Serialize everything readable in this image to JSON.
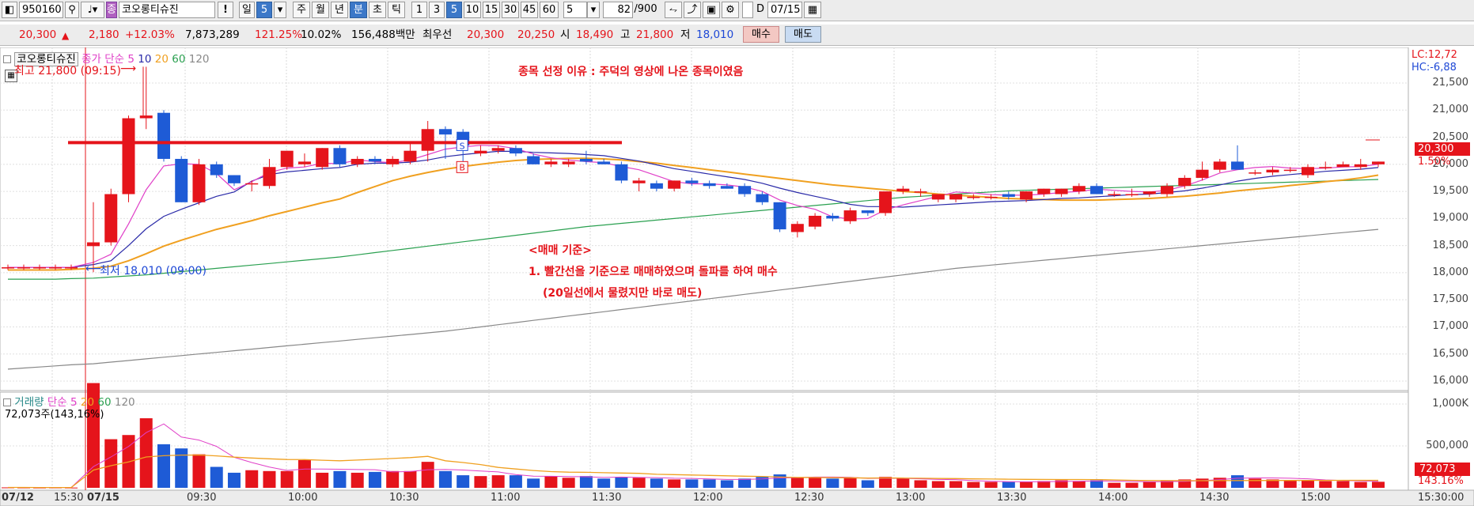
{
  "toolbar": {
    "code": "950160",
    "stock_name": "코오롱티슈진",
    "bang": "!",
    "day": "일",
    "day_count": "5",
    "week": "주",
    "month": "월",
    "year": "년",
    "minute": "분",
    "second": "초",
    "tick": "틱",
    "intervals": [
      "1",
      "3",
      "5",
      "10",
      "15",
      "30",
      "45",
      "60"
    ],
    "interval_value": "5",
    "count_value": "82",
    "count_total": "/900",
    "d_label": "D",
    "date": "07/15"
  },
  "infobar": {
    "price": "20,300",
    "change_arrow": "▲",
    "change": "2,180",
    "change_pct": "+12.03%",
    "volume": "7,873,289",
    "volume_ratio": "121.25%",
    "turnover": "10.02%",
    "trade_value": "156,488백만",
    "best_label": "최우선",
    "best_ask": "20,300",
    "best_bid": "20,250",
    "open_label": "시",
    "open": "18,490",
    "high_label": "고",
    "high": "21,800",
    "low_label": "저",
    "low": "18,010",
    "buy_button": "매수",
    "sell_button": "매도"
  },
  "price_legend": {
    "name": "코오롱티슈진",
    "close_label": "종가 단순",
    "ma5": "5",
    "ma10": "10",
    "ma20": "20",
    "ma60": "60",
    "ma120": "120"
  },
  "volume_legend": {
    "label": "거래량",
    "simple": "단순",
    "ma5": "5",
    "ma20": "20",
    "ma60": "60",
    "ma120": "120",
    "current": "72,073주(143,16%)"
  },
  "annotations": {
    "high_marker": "최고 21,800 (09:15)",
    "low_marker": "최저 18,010 (09:00)",
    "reason": "종목 선정 이유 : 주덕의 영상에 나온 종목이였음",
    "rule_title": "<매매 기준>",
    "rule_1": "1. 빨간선을 기준으로 매매하였으며 돌파를 하여 매수",
    "rule_2": "(20일선에서 물렸지만 바로 매도)",
    "lc": "LC:12,72",
    "hc": "HC:-6,88",
    "price_tag": "20,300",
    "pct_tag": "1.50%",
    "vol_tag": "72,073",
    "vol_pct_tag": "143.16%",
    "s_marker": "S",
    "b_marker": "B",
    "b_marker2": "B"
  },
  "colors": {
    "up": "#e5141b",
    "down": "#1e5bd6",
    "ma5": "#e040c8",
    "ma10": "#2a2aa8",
    "ma20": "#f0a020",
    "ma60": "#2aa050",
    "ma120": "#888888",
    "resistance": "#e5141b"
  },
  "chart_data": {
    "type": "candlestick",
    "price_axis": {
      "min": 16000,
      "max": 21500,
      "ticks": [
        "21,500",
        "21,000",
        "20,500",
        "20,000",
        "19,500",
        "19,000",
        "18,500",
        "18,000",
        "17,500",
        "17,000",
        "16,500",
        "16,000"
      ]
    },
    "volume_axis": {
      "ticks": [
        "1,000K",
        "500,000"
      ]
    },
    "x_labels": [
      "07/12",
      "15:30",
      "07/15",
      "09:30",
      "10:00",
      "10:30",
      "11:00",
      "11:30",
      "12:00",
      "12:30",
      "13:00",
      "13:30",
      "14:00",
      "14:30",
      "15:00",
      "15:30:00"
    ],
    "resistance_line": 20400,
    "candles": [
      {
        "o": 18100,
        "h": 18150,
        "l": 18050,
        "c": 18100
      },
      {
        "o": 18100,
        "h": 18150,
        "l": 18050,
        "c": 18100
      },
      {
        "o": 18100,
        "h": 18150,
        "l": 18050,
        "c": 18100
      },
      {
        "o": 18100,
        "h": 18150,
        "l": 18050,
        "c": 18100
      },
      {
        "o": 18100,
        "h": 18150,
        "l": 18050,
        "c": 18100
      },
      {
        "o": 18490,
        "h": 19300,
        "l": 18010,
        "c": 18560
      },
      {
        "o": 18560,
        "h": 19550,
        "l": 18500,
        "c": 19450
      },
      {
        "o": 19450,
        "h": 20900,
        "l": 19300,
        "c": 20850
      },
      {
        "o": 20850,
        "h": 21800,
        "l": 20650,
        "c": 20900
      },
      {
        "o": 20950,
        "h": 21000,
        "l": 20050,
        "c": 20100
      },
      {
        "o": 20100,
        "h": 20150,
        "l": 19300,
        "c": 19300
      },
      {
        "o": 19300,
        "h": 20100,
        "l": 19250,
        "c": 20000
      },
      {
        "o": 20000,
        "h": 20050,
        "l": 19750,
        "c": 19800
      },
      {
        "o": 19800,
        "h": 19800,
        "l": 19600,
        "c": 19650
      },
      {
        "o": 19650,
        "h": 19700,
        "l": 19500,
        "c": 19650
      },
      {
        "o": 19600,
        "h": 20100,
        "l": 19550,
        "c": 19950
      },
      {
        "o": 19950,
        "h": 20250,
        "l": 19900,
        "c": 20250
      },
      {
        "o": 20000,
        "h": 20200,
        "l": 19950,
        "c": 20050
      },
      {
        "o": 19950,
        "h": 20300,
        "l": 19900,
        "c": 20300
      },
      {
        "o": 20300,
        "h": 20350,
        "l": 19950,
        "c": 20000
      },
      {
        "o": 20000,
        "h": 20150,
        "l": 19950,
        "c": 20100
      },
      {
        "o": 20100,
        "h": 20150,
        "l": 20000,
        "c": 20050
      },
      {
        "o": 20000,
        "h": 20150,
        "l": 19950,
        "c": 20100
      },
      {
        "o": 20050,
        "h": 20400,
        "l": 20000,
        "c": 20250
      },
      {
        "o": 20250,
        "h": 20800,
        "l": 20050,
        "c": 20650
      },
      {
        "o": 20650,
        "h": 20700,
        "l": 20100,
        "c": 20550
      },
      {
        "o": 20600,
        "h": 20650,
        "l": 20050,
        "c": 20350
      },
      {
        "o": 20200,
        "h": 20350,
        "l": 20150,
        "c": 20250
      },
      {
        "o": 20250,
        "h": 20350,
        "l": 20200,
        "c": 20300
      },
      {
        "o": 20300,
        "h": 20350,
        "l": 20150,
        "c": 20200
      },
      {
        "o": 20150,
        "h": 20200,
        "l": 20000,
        "c": 20000
      },
      {
        "o": 20000,
        "h": 20100,
        "l": 19950,
        "c": 20050
      },
      {
        "o": 20000,
        "h": 20100,
        "l": 19950,
        "c": 20050
      },
      {
        "o": 20100,
        "h": 20250,
        "l": 20000,
        "c": 20050
      },
      {
        "o": 20050,
        "h": 20100,
        "l": 20000,
        "c": 20000
      },
      {
        "o": 20000,
        "h": 20050,
        "l": 19650,
        "c": 19700
      },
      {
        "o": 19650,
        "h": 19750,
        "l": 19500,
        "c": 19700
      },
      {
        "o": 19650,
        "h": 19700,
        "l": 19500,
        "c": 19550
      },
      {
        "o": 19550,
        "h": 19700,
        "l": 19500,
        "c": 19700
      },
      {
        "o": 19700,
        "h": 19750,
        "l": 19600,
        "c": 19650
      },
      {
        "o": 19650,
        "h": 19700,
        "l": 19550,
        "c": 19600
      },
      {
        "o": 19600,
        "h": 19650,
        "l": 19550,
        "c": 19550
      },
      {
        "o": 19600,
        "h": 19650,
        "l": 19400,
        "c": 19450
      },
      {
        "o": 19450,
        "h": 19500,
        "l": 19250,
        "c": 19300
      },
      {
        "o": 19300,
        "h": 19300,
        "l": 18750,
        "c": 18800
      },
      {
        "o": 18750,
        "h": 18950,
        "l": 18650,
        "c": 18900
      },
      {
        "o": 18850,
        "h": 19100,
        "l": 18800,
        "c": 19050
      },
      {
        "o": 19050,
        "h": 19100,
        "l": 18950,
        "c": 19000
      },
      {
        "o": 18950,
        "h": 19200,
        "l": 18900,
        "c": 19150
      },
      {
        "o": 19150,
        "h": 19150,
        "l": 19050,
        "c": 19100
      },
      {
        "o": 19100,
        "h": 19500,
        "l": 19050,
        "c": 19500
      },
      {
        "o": 19500,
        "h": 19600,
        "l": 19450,
        "c": 19550
      },
      {
        "o": 19500,
        "h": 19550,
        "l": 19400,
        "c": 19500
      },
      {
        "o": 19350,
        "h": 19450,
        "l": 19300,
        "c": 19450
      },
      {
        "o": 19350,
        "h": 19450,
        "l": 19300,
        "c": 19450
      },
      {
        "o": 19400,
        "h": 19450,
        "l": 19350,
        "c": 19400
      },
      {
        "o": 19400,
        "h": 19450,
        "l": 19350,
        "c": 19400
      },
      {
        "o": 19450,
        "h": 19500,
        "l": 19350,
        "c": 19400
      },
      {
        "o": 19350,
        "h": 19500,
        "l": 19300,
        "c": 19500
      },
      {
        "o": 19450,
        "h": 19550,
        "l": 19400,
        "c": 19550
      },
      {
        "o": 19450,
        "h": 19550,
        "l": 19400,
        "c": 19550
      },
      {
        "o": 19500,
        "h": 19650,
        "l": 19450,
        "c": 19600
      },
      {
        "o": 19600,
        "h": 19650,
        "l": 19450,
        "c": 19450
      },
      {
        "o": 19450,
        "h": 19500,
        "l": 19400,
        "c": 19450
      },
      {
        "o": 19450,
        "h": 19550,
        "l": 19400,
        "c": 19450
      },
      {
        "o": 19450,
        "h": 19500,
        "l": 19400,
        "c": 19500
      },
      {
        "o": 19450,
        "h": 19650,
        "l": 19400,
        "c": 19600
      },
      {
        "o": 19600,
        "h": 19800,
        "l": 19550,
        "c": 19750
      },
      {
        "o": 19750,
        "h": 20050,
        "l": 19700,
        "c": 19900
      },
      {
        "o": 19900,
        "h": 20100,
        "l": 19850,
        "c": 20050
      },
      {
        "o": 20050,
        "h": 20350,
        "l": 19950,
        "c": 19900
      },
      {
        "o": 19850,
        "h": 19900,
        "l": 19800,
        "c": 19850
      },
      {
        "o": 19850,
        "h": 19950,
        "l": 19800,
        "c": 19900
      },
      {
        "o": 19900,
        "h": 19950,
        "l": 19850,
        "c": 19900
      },
      {
        "o": 19800,
        "h": 20000,
        "l": 19750,
        "c": 19950
      },
      {
        "o": 19950,
        "h": 20050,
        "l": 19900,
        "c": 19950
      },
      {
        "o": 19950,
        "h": 20050,
        "l": 19950,
        "c": 20000
      },
      {
        "o": 19950,
        "h": 20100,
        "l": 19900,
        "c": 20000
      },
      {
        "o": 20000,
        "h": 20050,
        "l": 19950,
        "c": 20050
      }
    ],
    "volumes": [
      5,
      4,
      3,
      4,
      3,
      1250,
      580,
      630,
      830,
      520,
      470,
      400,
      250,
      180,
      210,
      200,
      200,
      330,
      180,
      200,
      180,
      190,
      200,
      200,
      310,
      200,
      150,
      140,
      150,
      150,
      110,
      140,
      120,
      140,
      110,
      130,
      120,
      110,
      100,
      100,
      100,
      90,
      110,
      130,
      160,
      120,
      120,
      110,
      120,
      90,
      130,
      110,
      90,
      80,
      80,
      70,
      70,
      70,
      70,
      80,
      90,
      80,
      90,
      60,
      60,
      70,
      90,
      100,
      110,
      120,
      150,
      110,
      100,
      90,
      90,
      80,
      80,
      70,
      72
    ],
    "ma5": [
      18100,
      18100,
      18100,
      18100,
      18100,
      18190,
      18340,
      18900,
      19530,
      19970,
      20010,
      20000,
      19830,
      19530,
      19680,
      19850,
      19930,
      19950,
      20020,
      20010,
      20080,
      20050,
      20030,
      20080,
      20180,
      20280,
      20320,
      20350,
      20340,
      20290,
      20190,
      20120,
      20080,
      20050,
      20030,
      19960,
      19900,
      19790,
      19680,
      19640,
      19640,
      19620,
      19580,
      19500,
      19340,
      19240,
      19170,
      19030,
      18990,
      19000,
      19160,
      19250,
      19330,
      19410,
      19490,
      19470,
      19440,
      19430,
      19430,
      19450,
      19480,
      19500,
      19540,
      19520,
      19500,
      19490,
      19520,
      19600,
      19710,
      19840,
      19900,
      19940,
      19960,
      19930,
      19920,
      19930,
      19950,
      19960,
      20000
    ],
    "ma10": [
      18100,
      18100,
      18100,
      18100,
      18100,
      18150,
      18220,
      18500,
      18810,
      19040,
      19170,
      19290,
      19410,
      19490,
      19690,
      19810,
      19860,
      19890,
      19920,
      19940,
      20000,
      20020,
      20020,
      20040,
      20080,
      20140,
      20180,
      20210,
      20240,
      20240,
      20220,
      20210,
      20200,
      20180,
      20160,
      20110,
      20060,
      19990,
      19920,
      19870,
      19820,
      19770,
      19720,
      19650,
      19560,
      19480,
      19410,
      19340,
      19260,
      19220,
      19220,
      19210,
      19230,
      19250,
      19270,
      19290,
      19310,
      19320,
      19330,
      19350,
      19370,
      19380,
      19400,
      19420,
      19440,
      19450,
      19480,
      19510,
      19560,
      19620,
      19690,
      19740,
      19780,
      19810,
      19840,
      19870,
      19890,
      19910,
      19940
    ],
    "ma20": [
      18050,
      18050,
      18050,
      18050,
      18060,
      18080,
      18120,
      18220,
      18350,
      18490,
      18600,
      18700,
      18800,
      18880,
      18960,
      19050,
      19130,
      19210,
      19290,
      19360,
      19480,
      19590,
      19700,
      19780,
      19850,
      19910,
      19960,
      20000,
      20040,
      20070,
      20090,
      20100,
      20110,
      20110,
      20100,
      20080,
      20050,
      20020,
      19980,
      19940,
      19900,
      19860,
      19820,
      19780,
      19740,
      19700,
      19660,
      19620,
      19590,
      19560,
      19530,
      19500,
      19480,
      19450,
      19430,
      19410,
      19390,
      19370,
      19360,
      19350,
      19340,
      19340,
      19340,
      19350,
      19360,
      19370,
      19390,
      19410,
      19440,
      19470,
      19510,
      19540,
      19570,
      19610,
      19640,
      19680,
      19710,
      19750,
      19800
    ],
    "ma60": [
      17880,
      17880,
      17880,
      17880,
      17890,
      17900,
      17920,
      17940,
      17960,
      17990,
      18020,
      18050,
      18080,
      18110,
      18140,
      18170,
      18200,
      18230,
      18260,
      18290,
      18330,
      18370,
      18410,
      18450,
      18490,
      18530,
      18570,
      18610,
      18650,
      18690,
      18730,
      18770,
      18810,
      18850,
      18880,
      18910,
      18940,
      18970,
      19000,
      19030,
      19060,
      19090,
      19120,
      19150,
      19180,
      19210,
      19240,
      19270,
      19300,
      19330,
      19360,
      19390,
      19410,
      19430,
      19450,
      19470,
      19490,
      19510,
      19520,
      19530,
      19540,
      19550,
      19560,
      19570,
      19580,
      19590,
      19600,
      19610,
      19620,
      19630,
      19640,
      19650,
      19660,
      19670,
      19680,
      19690,
      19700,
      19710,
      19720
    ],
    "ma120": [
      16220,
      16240,
      16260,
      16280,
      16300,
      16320,
      16350,
      16380,
      16410,
      16440,
      16470,
      16500,
      16530,
      16560,
      16590,
      16620,
      16650,
      16680,
      16710,
      16740,
      16770,
      16800,
      16830,
      16860,
      16890,
      16920,
      16960,
      17000,
      17040,
      17080,
      17120,
      17160,
      17200,
      17240,
      17280,
      17320,
      17360,
      17400,
      17440,
      17480,
      17520,
      17560,
      17600,
      17640,
      17680,
      17720,
      17760,
      17800,
      17840,
      17880,
      17920,
      17960,
      18000,
      18040,
      18080,
      18110,
      18140,
      18170,
      18200,
      18230,
      18260,
      18290,
      18320,
      18350,
      18380,
      18410,
      18440,
      18470,
      18500,
      18530,
      18560,
      18590,
      18620,
      18650,
      18680,
      18710,
      18740,
      18770,
      18800
    ]
  }
}
